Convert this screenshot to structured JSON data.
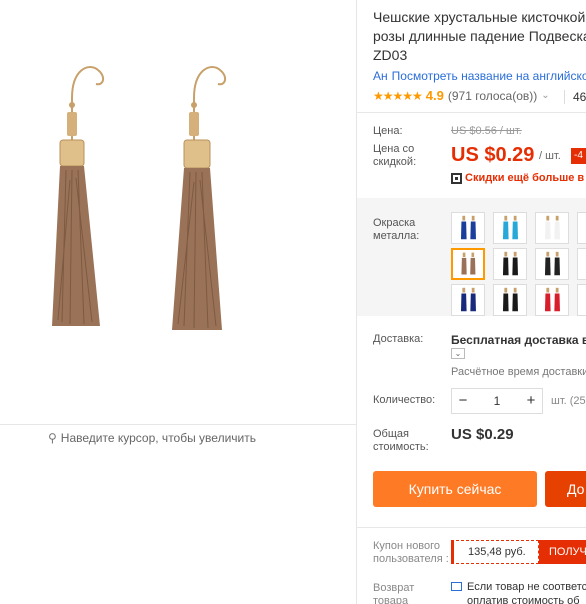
{
  "colors": {
    "price_red": "#e62e04",
    "buy_orange": "#ff7a25",
    "cart_red": "#e64100",
    "star": "#ff9900",
    "link_blue": "#2a6ed8",
    "tassel": "#9a7257"
  },
  "image": {
    "zoom_hint": "Наведите курсор, чтобы увеличить",
    "zoom_icon": "magnifier-icon"
  },
  "title_lines": [
    "Чешские хрустальные кисточкой",
    "розы длинные падение Подвеска",
    "ZD03"
  ],
  "translate": {
    "icon": "translate-icon",
    "label": "Посмотреть название на английско"
  },
  "rating": {
    "stars": "★★★★★",
    "value": "4.9",
    "votes": "(971 голоса(ов))",
    "orders": "46"
  },
  "price": {
    "label": "Цена:",
    "old": "US $0.56 / шт.",
    "discount_label": "Цена со скидкой:",
    "current": "US $0.29",
    "per": "/ шт.",
    "badge": "-4",
    "promo": "Скидки ещё больше в п"
  },
  "metal": {
    "label": "Окраска металла:",
    "swatches": [
      {
        "name": "blue-long",
        "color": "#1a3f9a",
        "selected": false
      },
      {
        "name": "sky-blue",
        "color": "#28a8d8",
        "selected": false
      },
      {
        "name": "white",
        "color": "#f2f2f2",
        "selected": false
      },
      {
        "name": "black-gold",
        "color": "#222222",
        "selected": false
      },
      {
        "name": "brown",
        "color": "#9a7257",
        "selected": true
      },
      {
        "name": "black",
        "color": "#1a1a1a",
        "selected": false
      },
      {
        "name": "black-silver",
        "color": "#222222",
        "selected": false
      },
      {
        "name": "black-2",
        "color": "#1a1a1a",
        "selected": false
      },
      {
        "name": "navy",
        "color": "#1a2a7a",
        "selected": false
      },
      {
        "name": "black-3",
        "color": "#1a1a1a",
        "selected": false
      },
      {
        "name": "red",
        "color": "#d81e2a",
        "selected": false
      },
      {
        "name": "red-2",
        "color": "#c8102e",
        "selected": false
      }
    ]
  },
  "shipping": {
    "label": "Доставка:",
    "value": "Бесплатная доставка в R",
    "toggle": "⌄",
    "time": "Расчётное время доставки"
  },
  "quantity": {
    "label": "Количество:",
    "minus": "−",
    "value": "1",
    "plus": "+",
    "unit": "шт. (25"
  },
  "total": {
    "label": "Общая стоимость:",
    "value": "US $0.29"
  },
  "actions": {
    "buy": "Купить сейчас",
    "cart": "До"
  },
  "coupon": {
    "label": "Купон нового пользователя :",
    "value": "135,48 руб.",
    "button": "ПОЛУЧ"
  },
  "returns": {
    "label": "Возврат товара",
    "lines": [
      "Если товар не соответс",
      "оплатив стоимость об"
    ]
  }
}
